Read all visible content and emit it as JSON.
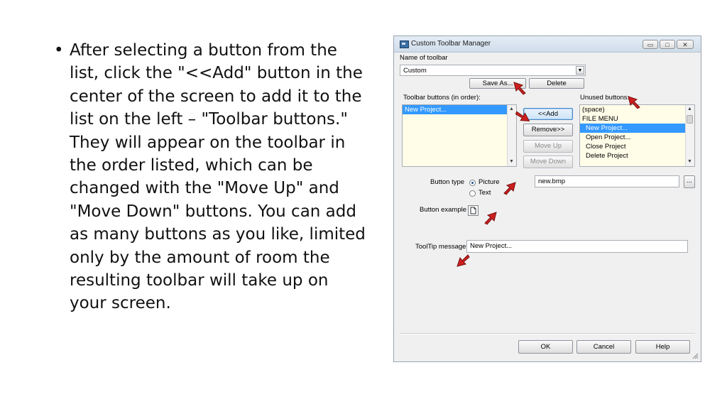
{
  "slide": {
    "bullet_char": "•",
    "text": "After selecting a button from the list, click the \"<<Add\" button in the center of the screen to add it to the list on the left – \"Toolbar buttons.\" They will appear on the toolbar in the order listed, which can be changed with the \"Move Up\" and \"Move Down\" buttons. You can add as many buttons as you like, limited only by the amount of room the resulting toolbar will take up on your screen."
  },
  "dialog": {
    "title": "Custom Toolbar Manager",
    "window_buttons": {
      "minimize": "▭",
      "maximize": "□",
      "close": "✕"
    },
    "name_label": "Name of toolbar",
    "name_value": "Custom",
    "save_as": "Save As...",
    "delete": "Delete",
    "toolbar_buttons_label": "Toolbar buttons (in order):",
    "toolbar_buttons": [
      "New Project..."
    ],
    "unused_label": "Unused buttons:",
    "unused_buttons": [
      "(space)",
      "FILE MENU",
      "New Project...",
      "Open Project...",
      "Close Project",
      "Delete Project"
    ],
    "unused_selected_index": 2,
    "add": "<<Add",
    "remove": "Remove>>",
    "move_up": "Move Up",
    "move_down": "Move Down",
    "button_type_label": "Button type",
    "radio_picture": "Picture",
    "radio_text": "Text",
    "picture_file": "new.bmp",
    "browse": "...",
    "button_example_label": "Button example",
    "tooltip_label": "ToolTip message:",
    "tooltip_value": "New Project...",
    "ok": "OK",
    "cancel": "Cancel",
    "help": "Help"
  },
  "colors": {
    "arrow": "#cc1f1f",
    "list_bg": "#fffde8",
    "selection": "#3399ff"
  }
}
